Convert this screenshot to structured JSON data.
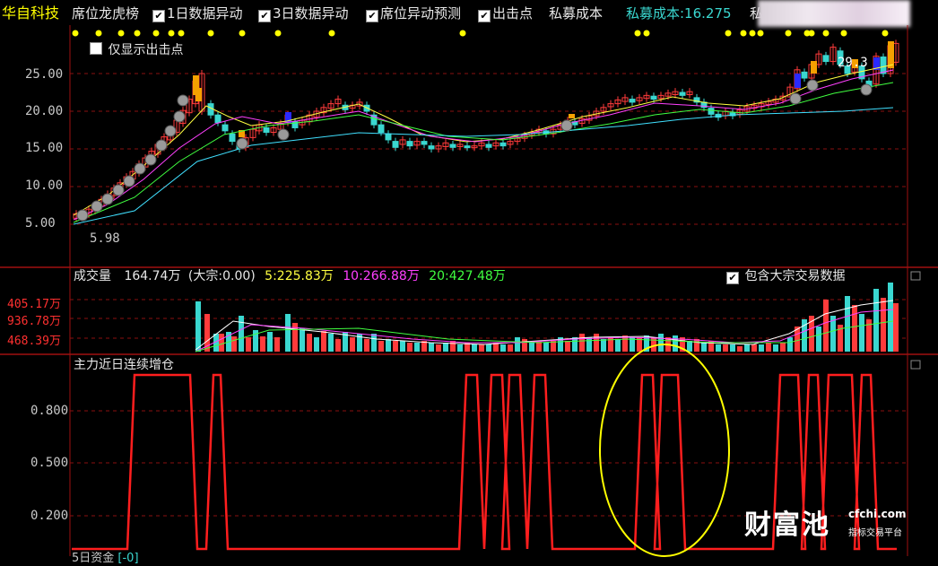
{
  "toolbar": {
    "stock_name": "华自科技",
    "seat_list": "席位龙虎榜",
    "opt1": "1日数据异动",
    "opt2": "3日数据异动",
    "opt3": "席位异动预测",
    "opt4": "出击点",
    "private_cost": "私募成本",
    "private_cost_value_label": "私募成本:16.275",
    "trailing": "私"
  },
  "main_panel": {
    "show_only_label": "仅显示出击点",
    "low_price_label": "5.98",
    "high_price_label": "29.3",
    "y_ticks": [
      "25.00",
      "20.00",
      "15.00",
      "10.00",
      "5.00"
    ]
  },
  "volume_panel": {
    "title": "成交量",
    "volume": "164.74万",
    "bulk": "(大宗:0.00)",
    "ma5": "5:225.83万",
    "ma10": "10:266.88万",
    "ma20": "20:427.48万",
    "include_bulk_label": "包含大宗交易数据",
    "y_ticks": [
      "405.17万",
      "936.78万",
      "468.39万"
    ]
  },
  "indicator_panel": {
    "title": "主力近日连续增仓",
    "y_ticks": [
      "0.800",
      "0.500",
      "0.200"
    ],
    "bottom_label": "5日资金",
    "bottom_value": "[-0]"
  },
  "watermark": {
    "brand": "财富池",
    "url": "cfchi.com",
    "sub": "指标交易平台"
  },
  "colors": {
    "up": "#ff3b3b",
    "down": "#3ad7d0",
    "accent_yellow": "#ffff00",
    "signal_line": "#ff1e1e",
    "ma_white": "#ffffff",
    "ma_yellow": "#ffff40",
    "ma_magenta": "#ff40ff",
    "ma_green": "#40ff40",
    "ma_cyan": "#40e0ff"
  }
}
